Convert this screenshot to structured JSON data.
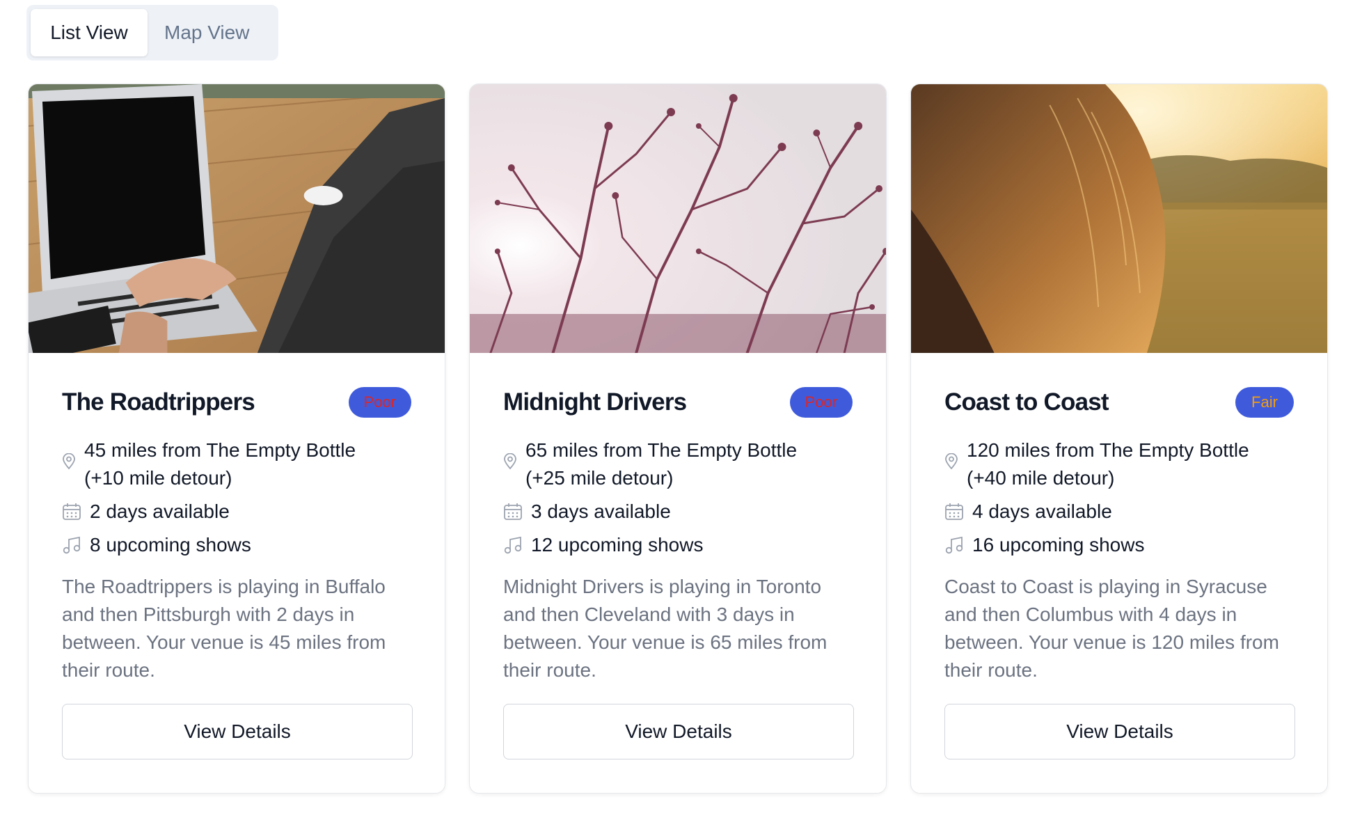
{
  "view_toggle": {
    "list_label": "List View",
    "map_label": "Map View",
    "active": "list"
  },
  "colors": {
    "badge_bg": "#3f5bdc",
    "poor_text": "#dc2626",
    "fair_text": "#f59e0b"
  },
  "cards": [
    {
      "title": "The Roadtrippers",
      "rating": "Poor",
      "distance_line1": "45 miles from The Empty Bottle",
      "distance_line2": "(+10 mile detour)",
      "days": "2 days available",
      "shows": "8 upcoming shows",
      "description": "The Roadtrippers is playing in Buffalo and then Pittsburgh with 2 days in between. Your venue is 45 miles from their route.",
      "button": "View Details",
      "image_alt": "laptop-photo"
    },
    {
      "title": "Midnight Drivers",
      "rating": "Poor",
      "distance_line1": "65 miles from The Empty Bottle",
      "distance_line2": "(+25 mile detour)",
      "days": "3 days available",
      "shows": "12 upcoming shows",
      "description": "Midnight Drivers is playing in Toronto and then Cleveland with 3 days in between. Your venue is 65 miles from their route.",
      "button": "View Details",
      "image_alt": "branches-photo"
    },
    {
      "title": "Coast to Coast",
      "rating": "Fair",
      "distance_line1": "120 miles from The Empty Bottle",
      "distance_line2": "(+40 mile detour)",
      "days": "4 days available",
      "shows": "16 upcoming shows",
      "description": "Coast to Coast is playing in Syracuse and then Columbus with 4 days in between. Your venue is 120 miles from their route.",
      "button": "View Details",
      "image_alt": "sunset-hair-photo"
    }
  ]
}
